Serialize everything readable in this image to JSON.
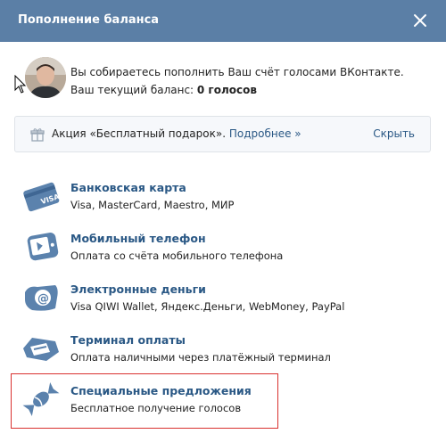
{
  "header": {
    "title": "Пополнение баланса"
  },
  "user": {
    "line1": "Вы собираетесь пополнить Ваш счёт голосами ВКонтакте.",
    "balance_label": "Ваш текущий баланс: ",
    "balance_value": "0 голосов"
  },
  "promo": {
    "text": "Акция «Бесплатный подарок».",
    "link": "Подробнее »",
    "hide": "Скрыть"
  },
  "methods": [
    {
      "title": "Банковская карта",
      "desc": "Visa, MasterCard, Maestro, МИР",
      "icon": "bank-card-icon"
    },
    {
      "title": "Мобильный телефон",
      "desc": "Оплата со счёта мобильного телефона",
      "icon": "mobile-phone-icon"
    },
    {
      "title": "Электронные деньги",
      "desc": "Visa QIWI Wallet, Яндекс.Деньги, WebMoney, PayPal",
      "icon": "e-money-icon"
    },
    {
      "title": "Терминал оплаты",
      "desc": "Оплата наличными через платёжный терминал",
      "icon": "payment-terminal-icon"
    },
    {
      "title": "Специальные предложения",
      "desc": "Бесплатное получение голосов",
      "icon": "candy-icon"
    }
  ],
  "colors": {
    "header_bg": "#5b7fa6",
    "link": "#2a5885",
    "icon": "#5b82ad",
    "highlight_border": "#d9312f"
  }
}
